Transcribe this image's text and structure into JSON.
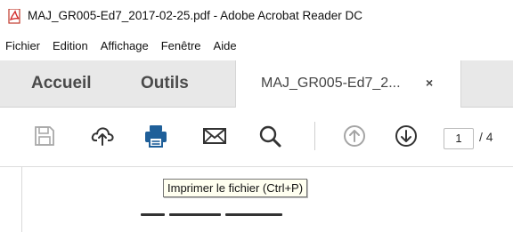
{
  "window": {
    "title": "MAJ_GR005-Ed7_2017-02-25.pdf - Adobe Acrobat Reader DC"
  },
  "menu": [
    "Fichier",
    "Edition",
    "Affichage",
    "Fenêtre",
    "Aide"
  ],
  "tabs": {
    "home": "Accueil",
    "tools": "Outils",
    "document": "MAJ_GR005-Ed7_2...",
    "close_glyph": "×"
  },
  "toolbar": {
    "icons": [
      "save-icon",
      "cloud-upload-icon",
      "print-icon",
      "mail-icon",
      "search-icon",
      "page-up-icon",
      "page-down-icon"
    ],
    "page_current": "1",
    "page_total": "/ 4",
    "print_color": "#1f5f99"
  },
  "tooltip": {
    "text": "Imprimer le fichier (Ctrl+P)"
  }
}
